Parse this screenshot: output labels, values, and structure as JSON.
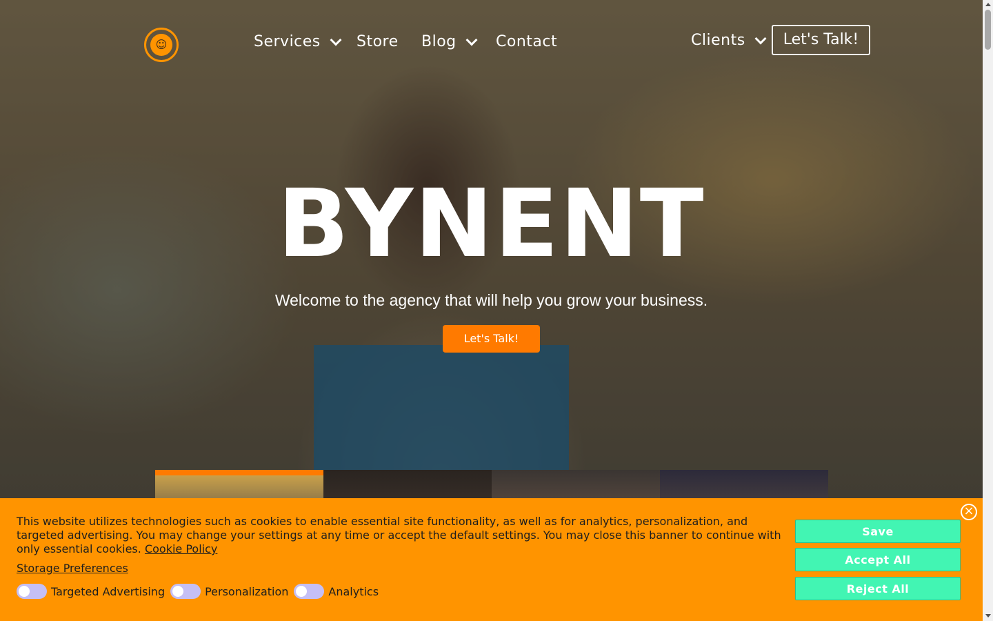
{
  "header": {
    "logo_icon": "people-icon",
    "nav": [
      {
        "label": "Services",
        "has_dropdown": true
      },
      {
        "label": "Store",
        "has_dropdown": false
      },
      {
        "label": "Blog",
        "has_dropdown": true
      },
      {
        "label": "Contact",
        "has_dropdown": false
      }
    ],
    "clients_label": "Clients",
    "cta_label": "Let's Talk!"
  },
  "hero": {
    "brand": "BYNENT",
    "tagline": "Welcome to the agency that will help you grow your business.",
    "cta_label": "Let's Talk!"
  },
  "cookie_banner": {
    "text": "This website utilizes technologies such as cookies to enable essential site functionality, as well as for analytics, personalization, and targeted advertising. You may change your settings at any time or accept the default settings. You may close this banner to continue with only essential cookies.",
    "policy_link": "Cookie Policy",
    "storage_preferences": "Storage Preferences",
    "toggles": [
      {
        "label": "Targeted Advertising",
        "on": false
      },
      {
        "label": "Personalization",
        "on": false
      },
      {
        "label": "Analytics",
        "on": false
      }
    ],
    "buttons": {
      "save": "Save",
      "accept_all": "Accept All",
      "reject_all": "Reject All"
    },
    "close_icon": "close-icon"
  },
  "colors": {
    "accent": "#ff9400",
    "cta": "#ff7a00",
    "cookie_button": "#42f5b3",
    "toggle_off": "#c5bff5"
  }
}
